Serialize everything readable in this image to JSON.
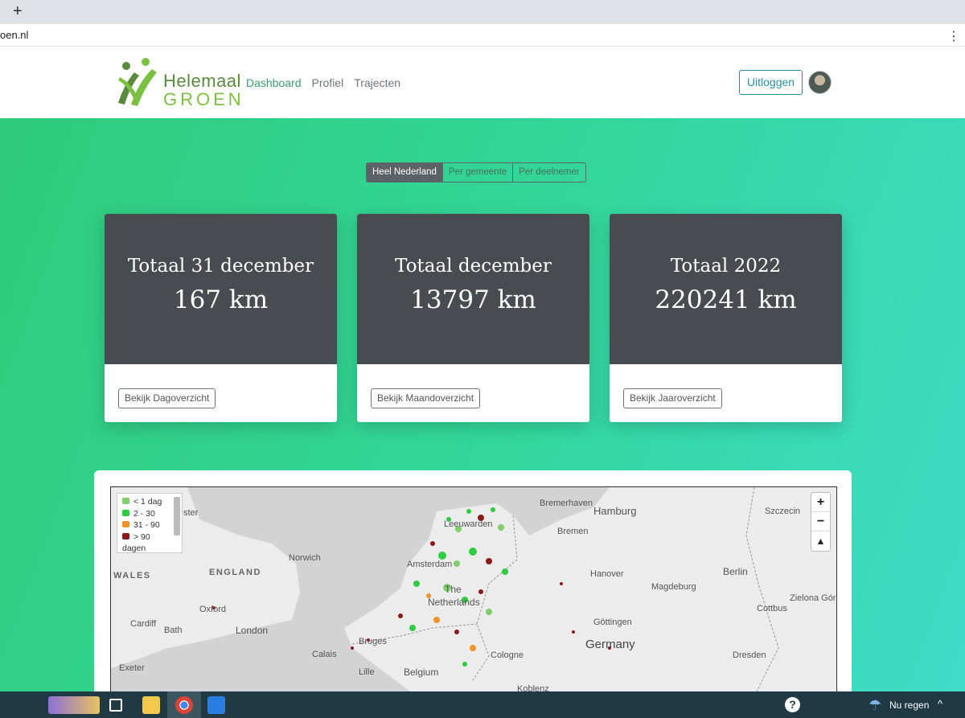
{
  "browser": {
    "new_tab": "+",
    "url": "oen.nl"
  },
  "header": {
    "logo_line1": "Helemaal",
    "logo_line2": "GROEN",
    "nav": [
      {
        "label": "Dashboard",
        "active": true
      },
      {
        "label": "Profiel",
        "active": false
      },
      {
        "label": "Trajecten",
        "active": false
      }
    ],
    "logout_label": "Uitloggen"
  },
  "toggle": [
    "Heel Nederland",
    "Per gemeente",
    "Per deelnemer"
  ],
  "cards": [
    {
      "title": "Totaal 31 december",
      "value": "167 km",
      "button": "Bekijk Dagoverzicht"
    },
    {
      "title": "Totaal december",
      "value": "13797 km",
      "button": "Bekijk Maandoverzicht"
    },
    {
      "title": "Totaal 2022",
      "value": "220241 km",
      "button": "Bekijk Jaaroverzicht"
    }
  ],
  "map": {
    "legend": [
      {
        "label": "< 1 dag",
        "color": "#7fcf6a"
      },
      {
        "label": "2 - 30",
        "color": "#2ecc40"
      },
      {
        "label": "31 - 90",
        "color": "#f0932b"
      },
      {
        "label": "> 90",
        "color": "#8b1a1a"
      },
      {
        "label": "dagen",
        "color": ""
      }
    ],
    "labels": {
      "bremerhaven": "Bremerhaven",
      "hamburg": "Hamburg",
      "szczecin": "Szczecin",
      "leeuwarden": "Leeuwarden",
      "bremen": "Bremen",
      "norwich": "Norwich",
      "wales": "WALES",
      "england": "ENGLAND",
      "amsterdam": "Amsterdam",
      "hanover": "Hanover",
      "berlin": "Berlin",
      "the": "The",
      "netherlands": "Netherlands",
      "magdeburg": "Magdeburg",
      "oxford": "Oxford",
      "cottbus": "Cottbus",
      "zielona": "Zielona Góra",
      "cardiff": "Cardiff",
      "gottingen": "Göttingen",
      "bath": "Bath",
      "london": "London",
      "germany": "Germany",
      "calais": "Calais",
      "bruges": "Bruges",
      "dresden": "Dresden",
      "exeter": "Exeter",
      "lille": "Lille",
      "belgium": "Belgium",
      "cologne": "Cologne",
      "koblenz": "Koblenz",
      "chester": "ster"
    },
    "zoom_in": "+",
    "zoom_out": "−",
    "reset": "▲"
  },
  "taskbar": {
    "help": "?",
    "weather": "Nu regen",
    "caret": "^"
  }
}
